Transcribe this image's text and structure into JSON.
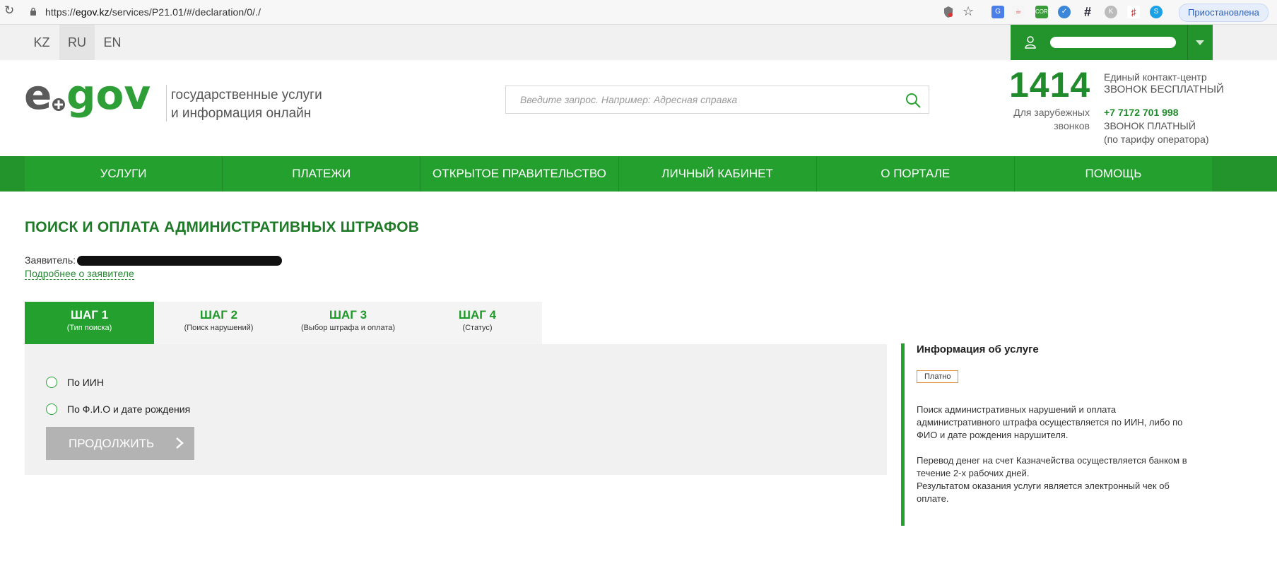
{
  "browser": {
    "url_prefix": "https://",
    "url_host": "egov.kz",
    "url_path": "/services/P21.01/#/declaration/0/./",
    "paused_label": "Приостановлена"
  },
  "lang": {
    "items": [
      "KZ",
      "RU",
      "EN"
    ],
    "active": "RU"
  },
  "header": {
    "tagline_line1": "государственные услуги",
    "tagline_line2": "и информация онлайн",
    "search_placeholder": "Введите запрос. Например: Адресная справка",
    "contact_number": "1414",
    "contact_center": "Единый контакт-центр",
    "free_call": "ЗВОНОК БЕСПЛАТНЫЙ",
    "foreign_line1": "Для зарубежных",
    "foreign_line2": "звонков",
    "foreign_phone": "+7 7172 701 998",
    "paid_call": "ЗВОНОК ПЛАТНЫЙ",
    "operator_rate": "(по тарифу оператора)"
  },
  "nav": {
    "items": [
      "УСЛУГИ",
      "ПЛАТЕЖИ",
      "ОТКРЫТОЕ ПРАВИТЕЛЬСТВО",
      "ЛИЧНЫЙ КАБИНЕТ",
      "О ПОРТАЛЕ",
      "ПОМОЩЬ"
    ]
  },
  "main": {
    "title": "ПОИСК И ОПЛАТА АДМИНИСТРАТИВНЫХ ШТРАФОВ",
    "applicant_label": "Заявитель:",
    "more_link": "Подробнее о заявителе",
    "steps": [
      {
        "title": "ШАГ 1",
        "subtitle": "(Тип поиска)"
      },
      {
        "title": "ШАГ 2",
        "subtitle": "(Поиск нарушений)"
      },
      {
        "title": "ШАГ 3",
        "subtitle": "(Выбор штрафа и оплата)"
      },
      {
        "title": "ШАГ 4",
        "subtitle": "(Статус)"
      }
    ],
    "options": [
      "По ИИН",
      "По Ф.И.О и дате рождения"
    ],
    "continue_label": "ПРОДОЛЖИТЬ"
  },
  "info": {
    "title": "Информация об услуге",
    "badge": "Платно",
    "p1": "Поиск административных нарушений и оплата административного штрафа осуществляется по ИИН, либо по ФИО и дате рождения нарушителя.",
    "p2": "Перевод денег на счет Казначейства осуществляется банком в течение 2-х рабочих дней.",
    "p3": "Результатом оказания услуги является электронный чек об оплате."
  },
  "colors": {
    "brand_green": "#23a02d",
    "title_green": "#1f7a28",
    "badge_border": "#e08a3a",
    "button_disabled": "#b3b3b3"
  }
}
